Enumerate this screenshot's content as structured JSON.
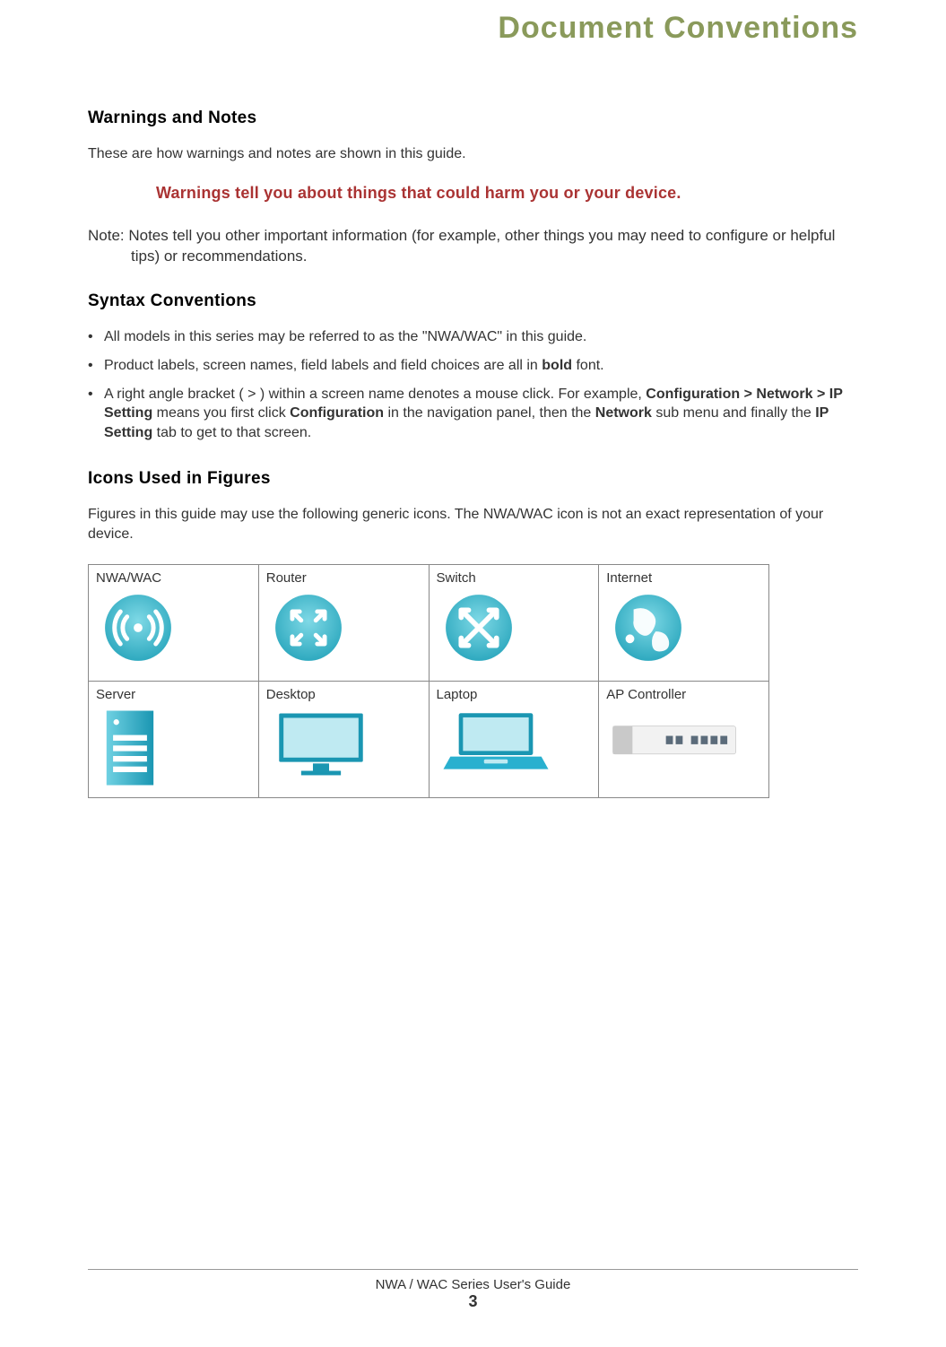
{
  "title": "Document Conventions",
  "sections": {
    "warnings_notes": {
      "heading": "Warnings and Notes",
      "intro": "These are how warnings and notes are shown in this guide.",
      "warning": "Warnings tell you about things that could harm you or your device.",
      "note": "Note: Notes tell you other important information (for example, other things you may need to configure or helpful tips) or recommendations."
    },
    "syntax": {
      "heading": "Syntax Conventions",
      "bullets": {
        "b1": "All models in this series may be referred to as the \"NWA/WAC\" in this guide.",
        "b2_pre": "Product labels, screen names, field labels and field choices are all in ",
        "b2_bold": "bold",
        "b2_post": " font.",
        "b3_pre": "A right angle bracket ( > ) within a screen name denotes a mouse click. For example, ",
        "b3_bold1": "Configuration > Network > IP Setting",
        "b3_mid1": " means you first click ",
        "b3_bold2": "Configuration",
        "b3_mid2": " in the navigation panel, then the ",
        "b3_bold3": "Network",
        "b3_mid3": " sub menu and finally the ",
        "b3_bold4": "IP Setting",
        "b3_post": " tab to get to that screen."
      }
    },
    "icons": {
      "heading": "Icons Used in Figures",
      "intro": "Figures in this guide may use the following generic icons. The NWA/WAC icon is not an exact representation of your device.",
      "grid": [
        {
          "label": "NWA/WAC",
          "icon": "nwa-wac-icon"
        },
        {
          "label": "Router",
          "icon": "router-icon"
        },
        {
          "label": "Switch",
          "icon": "switch-icon"
        },
        {
          "label": "Internet",
          "icon": "internet-icon"
        },
        {
          "label": "Server",
          "icon": "server-icon"
        },
        {
          "label": "Desktop",
          "icon": "desktop-icon"
        },
        {
          "label": "Laptop",
          "icon": "laptop-icon"
        },
        {
          "label": "AP Controller",
          "icon": "ap-controller-icon"
        }
      ]
    }
  },
  "footer": {
    "guide": "NWA / WAC Series User's Guide",
    "page": "3"
  }
}
